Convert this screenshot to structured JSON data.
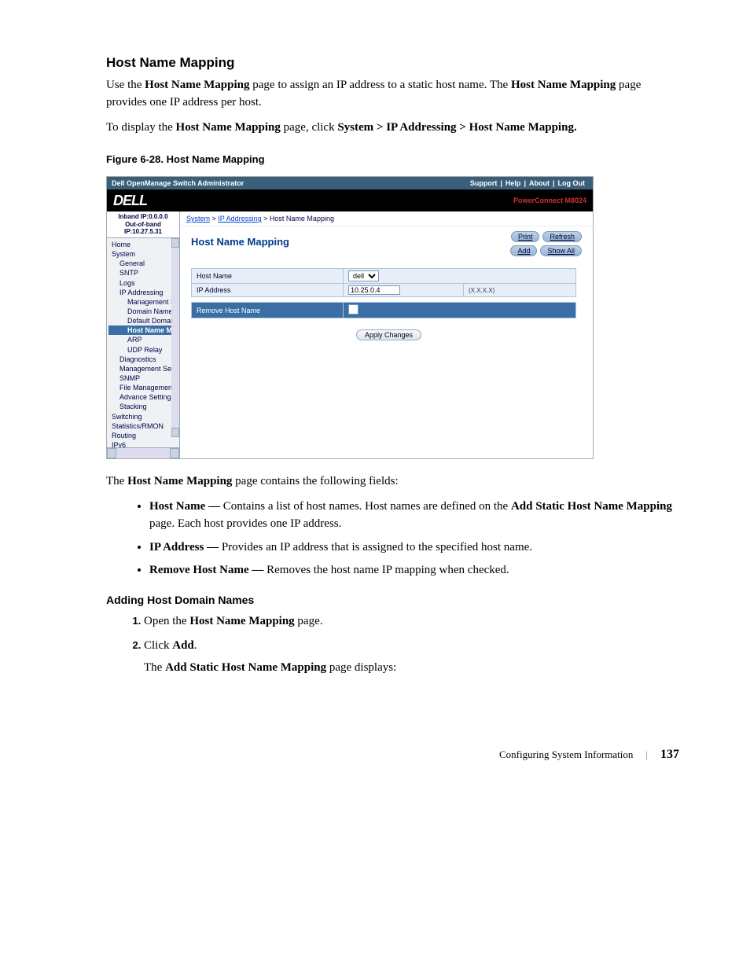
{
  "heading": "Host Name Mapping",
  "intro_pre": "Use the ",
  "intro_bold1": "Host Name Mapping",
  "intro_mid": " page to assign an IP address to a static host name. The ",
  "intro_bold2": "Host Name Mapping",
  "intro_post": " page provides one IP address per host.",
  "nav_pre": "To display the ",
  "nav_bold1": "Host Name Mapping",
  "nav_mid": " page, click ",
  "nav_bold2": "System > IP Addressing > Host Name Mapping.",
  "figure_caption": "Figure 6-28.    Host Name Mapping",
  "screenshot": {
    "topbar_title": "Dell OpenManage Switch Administrator",
    "topbar_links": [
      "Support",
      "Help",
      "About",
      "Log Out"
    ],
    "logo": "DELL",
    "model": "PowerConnect M8024",
    "ip_inband": "Inband IP:0.0.0.0",
    "ip_oob": "Out-of-band IP:10.27.5.31",
    "tree": [
      {
        "label": "Home",
        "lvl": 1,
        "sel": false
      },
      {
        "label": "System",
        "lvl": 1,
        "sel": false
      },
      {
        "label": "General",
        "lvl": 2,
        "sel": false
      },
      {
        "label": "SNTP",
        "lvl": 2,
        "sel": false
      },
      {
        "label": "Logs",
        "lvl": 2,
        "sel": false
      },
      {
        "label": "IP Addressing",
        "lvl": 2,
        "sel": false
      },
      {
        "label": "Management Int",
        "lvl": 3,
        "sel": false
      },
      {
        "label": "Domain Name S",
        "lvl": 3,
        "sel": false
      },
      {
        "label": "Default Domain N",
        "lvl": 3,
        "sel": false
      },
      {
        "label": "Host Name Map",
        "lvl": 3,
        "sel": true
      },
      {
        "label": "ARP",
        "lvl": 3,
        "sel": false
      },
      {
        "label": "UDP Relay",
        "lvl": 3,
        "sel": false
      },
      {
        "label": "Diagnostics",
        "lvl": 2,
        "sel": false
      },
      {
        "label": "Management Secur",
        "lvl": 2,
        "sel": false
      },
      {
        "label": "SNMP",
        "lvl": 2,
        "sel": false
      },
      {
        "label": "File Management",
        "lvl": 2,
        "sel": false
      },
      {
        "label": "Advance Settings",
        "lvl": 2,
        "sel": false
      },
      {
        "label": "Stacking",
        "lvl": 2,
        "sel": false
      },
      {
        "label": "Switching",
        "lvl": 1,
        "sel": false
      },
      {
        "label": "Statistics/RMON",
        "lvl": 1,
        "sel": false
      },
      {
        "label": "Routing",
        "lvl": 1,
        "sel": false
      },
      {
        "label": "IPv6",
        "lvl": 1,
        "sel": false
      }
    ],
    "breadcrumb": {
      "a": "System",
      "b": "IP Addressing",
      "c": "Host Name Mapping"
    },
    "panel_title": "Host Name Mapping",
    "buttons": {
      "print": "Print",
      "refresh": "Refresh",
      "add": "Add",
      "show_all": "Show All"
    },
    "form": {
      "host_name_label": "Host Name",
      "host_name_value": "dell",
      "ip_label": "IP Address",
      "ip_value": "10.25.0.4",
      "ip_hint": "(X.X.X.X)",
      "remove_label": "Remove Host Name"
    },
    "apply": "Apply Changes"
  },
  "after_fig": {
    "pre": "The ",
    "b": "Host Name Mapping",
    "post": " page contains the following fields:"
  },
  "fields": [
    {
      "name": "Host Name — ",
      "desc": "Contains a list of host names. Host names are defined on the ",
      "b": "Add Static Host Name Mapping",
      "post": " page. Each host provides one IP address."
    },
    {
      "name": "IP Address — ",
      "desc": "Provides an IP address that is assigned to the specified host name.",
      "b": "",
      "post": ""
    },
    {
      "name": "Remove Host Name — ",
      "desc": "Removes the host name IP mapping when checked.",
      "b": "",
      "post": ""
    }
  ],
  "sub_heading": "Adding Host Domain Names",
  "steps": {
    "s1_pre": "Open the ",
    "s1_b": "Host Name Mapping",
    "s1_post": " page.",
    "s2_pre": "Click ",
    "s2_b": "Add",
    "s2_post": ".",
    "s2_extra_pre": "The ",
    "s2_extra_b": "Add Static Host Name Mapping",
    "s2_extra_post": " page displays:"
  },
  "footer": {
    "section": "Configuring System Information",
    "page": "137"
  }
}
